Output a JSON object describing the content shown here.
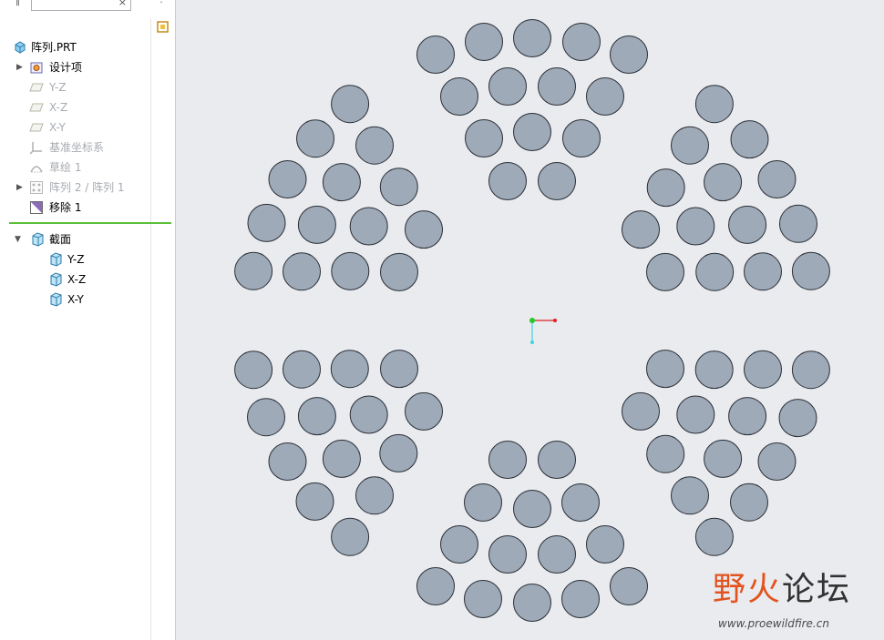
{
  "sidebar": {
    "search": {
      "value": "",
      "clear_label": "×"
    },
    "items": [
      {
        "label": "阵列.PRT",
        "dim": false,
        "expander": false,
        "icon": "part-icon",
        "indent": 0
      },
      {
        "label": "设计项",
        "dim": false,
        "expander": true,
        "icon": "design-items-icon",
        "indent": 0
      },
      {
        "label": "Y-Z",
        "dim": true,
        "expander": false,
        "icon": "datum-plane-icon",
        "indent": 0
      },
      {
        "label": "X-Z",
        "dim": true,
        "expander": false,
        "icon": "datum-plane-icon",
        "indent": 0
      },
      {
        "label": "X-Y",
        "dim": true,
        "expander": false,
        "icon": "datum-plane-icon",
        "indent": 0
      },
      {
        "label": "基准坐标系",
        "dim": true,
        "expander": false,
        "icon": "coordinate-system-icon",
        "indent": 0
      },
      {
        "label": "草绘 1",
        "dim": true,
        "expander": false,
        "icon": "sketch-icon",
        "indent": 0
      },
      {
        "label": "阵列 2 / 阵列 1",
        "dim": true,
        "expander": true,
        "icon": "pattern-icon",
        "indent": 0
      },
      {
        "label": "移除 1",
        "dim": false,
        "expander": false,
        "icon": "remove-icon",
        "indent": 0
      }
    ],
    "sections": {
      "label": "截面",
      "items": [
        {
          "label": "Y-Z",
          "icon": "section-icon"
        },
        {
          "label": "X-Z",
          "icon": "section-icon"
        },
        {
          "label": "X-Y",
          "icon": "section-icon"
        }
      ]
    }
  },
  "colors": {
    "hole_fill": "#9eaab8",
    "hole_stroke": "#2b2f36",
    "divider": "#5cbf3c",
    "canvas_bg": "#e9ebef",
    "axis_x": "#e02020",
    "axis_y": "#3fd3e0",
    "origin": "#28c828"
  },
  "watermark": {
    "title_a": "野火",
    "title_b": "论坛",
    "url": "www.proewildfire.cn"
  }
}
